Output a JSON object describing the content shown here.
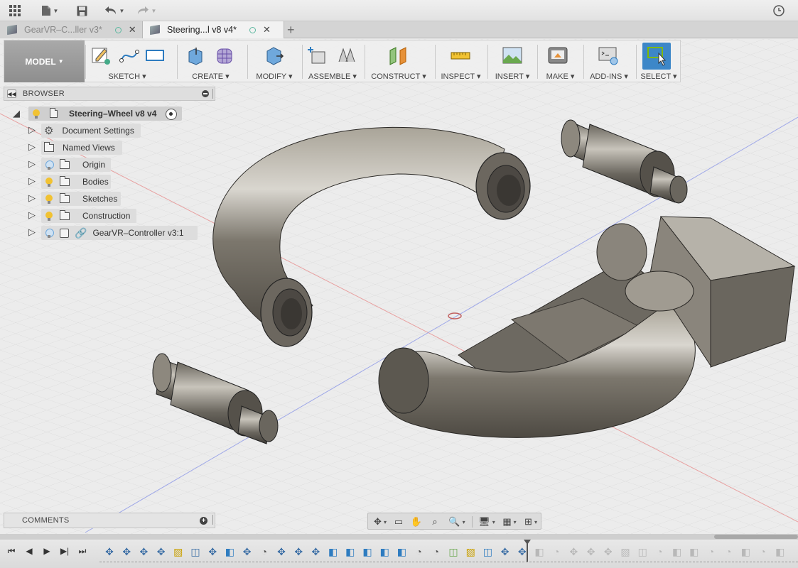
{
  "topbar": {
    "icons": [
      "grid-icon",
      "file-icon",
      "save-icon",
      "undo-icon",
      "redo-icon",
      "job-status-icon"
    ]
  },
  "tabs": [
    {
      "label": "GearVR–C...ller v3*",
      "active": false
    },
    {
      "label": "Steering...l v8 v4*",
      "active": true
    }
  ],
  "toolbar": {
    "workspace": "MODEL",
    "groups": [
      {
        "label": "SKETCH",
        "icons": [
          "create-sketch-icon",
          "spline-icon",
          "rectangle-icon"
        ]
      },
      {
        "label": "CREATE",
        "icons": [
          "extrude-icon",
          "form-icon"
        ]
      },
      {
        "label": "MODIFY",
        "icons": [
          "press-pull-icon"
        ]
      },
      {
        "label": "ASSEMBLE",
        "icons": [
          "new-component-icon",
          "joint-icon"
        ]
      },
      {
        "label": "CONSTRUCT",
        "icons": [
          "offset-plane-icon"
        ]
      },
      {
        "label": "INSPECT",
        "icons": [
          "measure-icon"
        ]
      },
      {
        "label": "INSERT",
        "icons": [
          "insert-image-icon"
        ]
      },
      {
        "label": "MAKE",
        "icons": [
          "3d-print-icon"
        ]
      },
      {
        "label": "ADD-INS",
        "icons": [
          "scripts-icon"
        ]
      },
      {
        "label": "SELECT",
        "icons": [
          "select-icon"
        ]
      }
    ]
  },
  "browser": {
    "title": "BROWSER",
    "root": "Steering–Wheel v8 v4",
    "items": [
      {
        "label": "Document Settings",
        "icon": "gear-icon"
      },
      {
        "label": "Named Views",
        "icon": "folder-icon"
      },
      {
        "label": "Origin",
        "icon": "folder-icon",
        "bulb": "off"
      },
      {
        "label": "Bodies",
        "icon": "folder-icon",
        "bulb": "on"
      },
      {
        "label": "Sketches",
        "icon": "folder-icon",
        "bulb": "on"
      },
      {
        "label": "Construction",
        "icon": "folder-icon",
        "bulb": "on"
      },
      {
        "label": "GearVR–Controller v3:1",
        "icon": "component-icon",
        "bulb": "off"
      }
    ]
  },
  "comments": {
    "title": "COMMENTS"
  },
  "navbar": {
    "icons": [
      "orbit-icon",
      "look-at-icon",
      "pan-icon",
      "zoom-icon",
      "fit-icon",
      "display-settings-icon",
      "grid-settings-icon",
      "viewports-icon"
    ]
  },
  "timeline": {
    "controls": [
      "skip-start-icon",
      "step-back-icon",
      "play-icon",
      "step-forward-icon",
      "skip-end-icon"
    ]
  },
  "colors": {
    "accent": "#2e7cc0",
    "model_button": "#9b9b9b",
    "body_metal": "#7a746a",
    "grid": "#dadada",
    "axis_red": "#e07a7a",
    "axis_blue": "#7a8ee0"
  }
}
